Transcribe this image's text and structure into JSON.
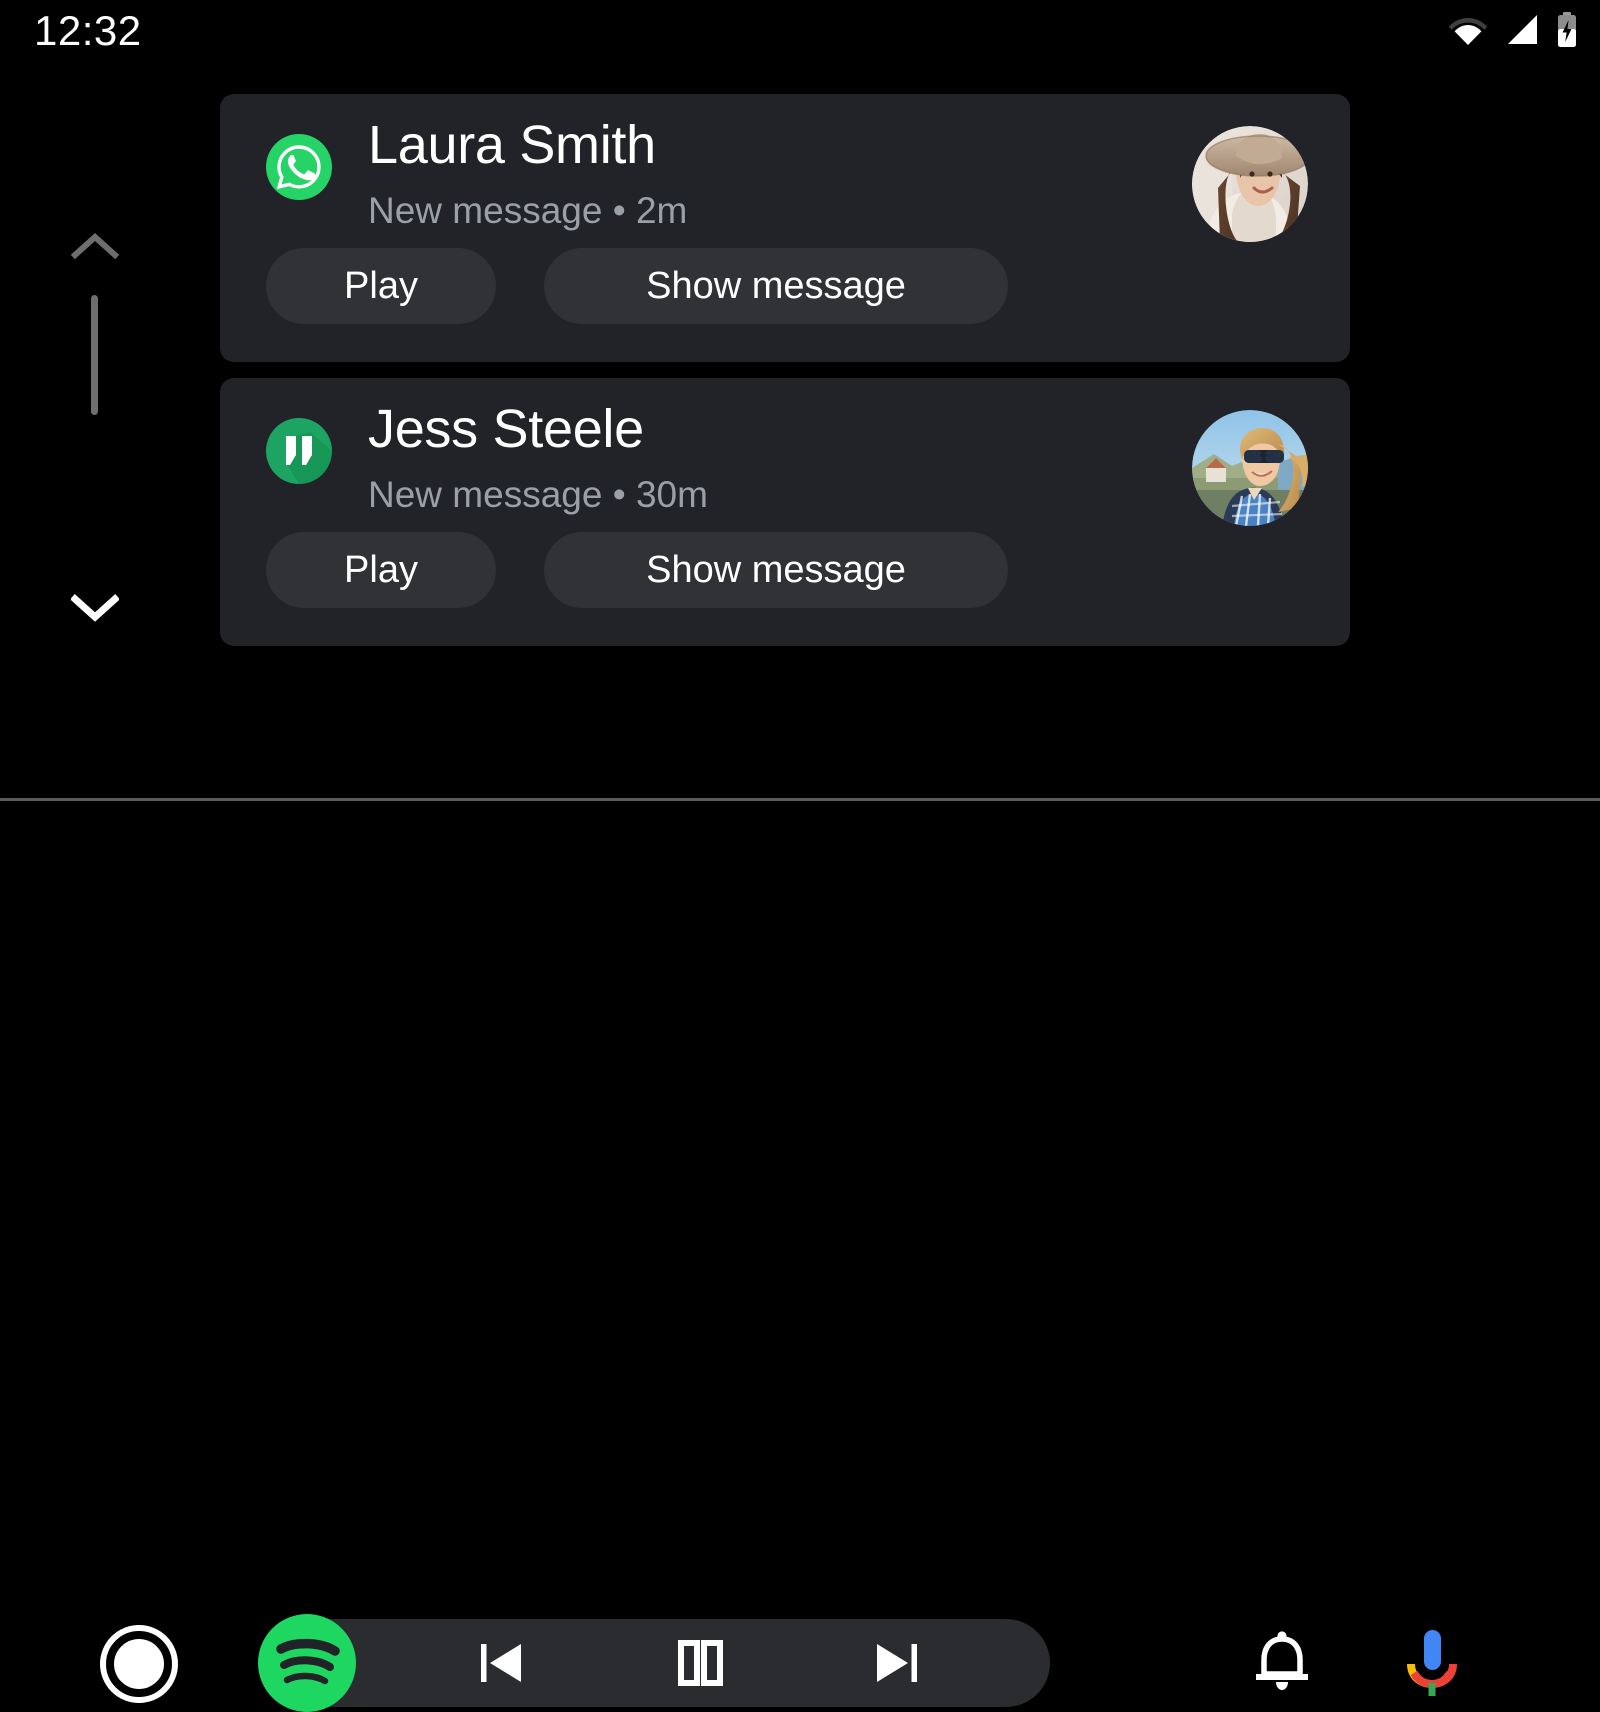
{
  "status_bar": {
    "clock": "12:32",
    "icons": [
      {
        "name": "wifi-icon",
        "label": "Wi-Fi"
      },
      {
        "name": "cell-signal-icon",
        "label": "Mobile signal"
      },
      {
        "name": "battery-charging-icon",
        "label": "Battery charging"
      }
    ]
  },
  "scroll": {
    "up_label": "Scroll up",
    "down_label": "Scroll down",
    "up_enabled": "false",
    "down_enabled": "true"
  },
  "notifications": [
    {
      "app_icon": "whatsapp-icon",
      "app_color": "#25D366",
      "title": "Laura Smith",
      "subtitle": "New message • 2m",
      "avatar": "avatar-laura",
      "actions": [
        {
          "name": "play-button",
          "label": "Play"
        },
        {
          "name": "show-message-button",
          "label": "Show message"
        }
      ]
    },
    {
      "app_icon": "hangouts-icon",
      "app_color": "#0F9D58",
      "title": "Jess Steele",
      "subtitle": "New message • 30m",
      "avatar": "avatar-jess",
      "actions": [
        {
          "name": "play-button",
          "label": "Play"
        },
        {
          "name": "show-message-button",
          "label": "Show message"
        }
      ]
    }
  ],
  "bottom_bar": {
    "home": {
      "name": "home-button",
      "label": "Home"
    },
    "media": {
      "app_icon": "spotify-icon",
      "app_color": "#1DD760",
      "controls": [
        {
          "name": "previous-track-button",
          "label": "Previous"
        },
        {
          "name": "pause-button",
          "label": "Pause"
        },
        {
          "name": "next-track-button",
          "label": "Next"
        }
      ]
    },
    "notifications_button": {
      "name": "notifications-bell-button",
      "label": "Notifications"
    },
    "assistant_button": {
      "name": "google-assistant-mic-button",
      "label": "Google Assistant"
    }
  },
  "colors": {
    "background": "#000000",
    "card": "#212328",
    "pill": "#303236",
    "media_pill": "#2A2C30",
    "text_primary": "#FFFFFF",
    "text_secondary": "#9AA0A6"
  }
}
